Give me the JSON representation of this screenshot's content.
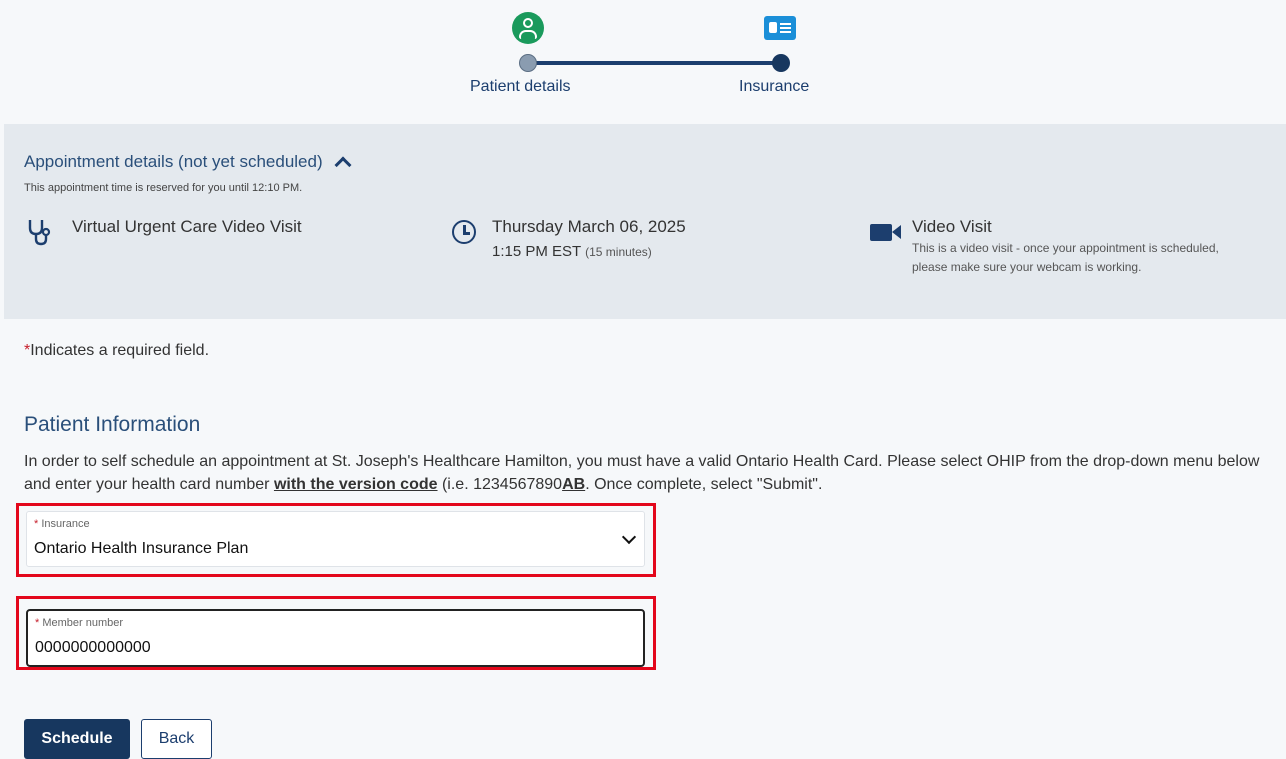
{
  "stepper": {
    "steps": [
      {
        "label": "Patient details",
        "icon": "person-icon"
      },
      {
        "label": "Insurance",
        "icon": "id-card-icon"
      }
    ]
  },
  "appointment": {
    "title": "Appointment details (not yet scheduled)",
    "reserved_note": "This appointment time is reserved for you until 12:10 PM.",
    "visit_type": "Virtual Urgent Care Video Visit",
    "date": "Thursday March 06, 2025",
    "time": "1:15 PM EST",
    "duration": "(15 minutes)",
    "mode_title": "Video Visit",
    "mode_desc": "This is a video visit - once your appointment is scheduled, please make sure your webcam is working."
  },
  "form": {
    "required_star": "*",
    "required_note": "Indicates a required field.",
    "section_title": "Patient Information",
    "instructions_part1": "In order to self schedule an appointment at St. Joseph's Healthcare Hamilton, you must have a valid Ontario Health Card. Please select OHIP from the drop-down menu below and enter your health card number ",
    "instructions_emphasis": "with the version code",
    "instructions_part2": " (i.e. 1234567890",
    "instructions_ab": "AB",
    "instructions_part3": ". Once complete, select \"Submit\".",
    "insurance_label": "Insurance",
    "insurance_value": "Ontario Health Insurance Plan",
    "member_label": "Member number",
    "member_value": "0000000000000"
  },
  "buttons": {
    "schedule": "Schedule",
    "back": "Back"
  },
  "colors": {
    "primary": "#17375f",
    "highlight": "#e3071b",
    "required": "#c6202c",
    "success": "#1a9a5c"
  }
}
